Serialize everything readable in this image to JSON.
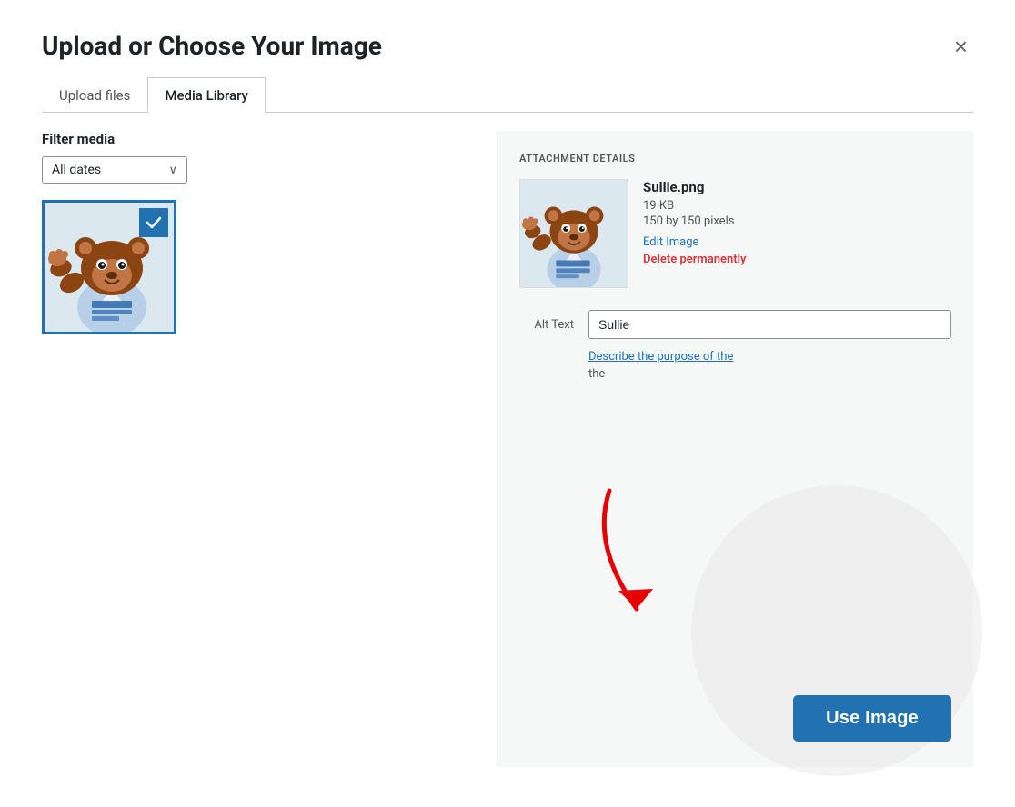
{
  "dialog": {
    "title": "Upload or Choose Your Image",
    "close_label": "×"
  },
  "tabs": [
    {
      "id": "upload",
      "label": "Upload files",
      "active": false
    },
    {
      "id": "library",
      "label": "Media Library",
      "active": true
    }
  ],
  "filter": {
    "label": "Filter media",
    "date_value": "All dates",
    "arrow": "∨"
  },
  "attachment_details": {
    "section_label": "ATTACHMENT DETAILS",
    "filename": "Sullie.png",
    "size": "19 KB",
    "dimensions": "150 by 150 pixels",
    "edit_link": "Edit Image",
    "delete_link": "Delete permanently"
  },
  "alt_text": {
    "label": "Alt Text",
    "value": "Sullie",
    "describe_link": "Describe the purpose of the",
    "more_text": "the"
  },
  "buttons": {
    "use_image": "Use Image"
  }
}
